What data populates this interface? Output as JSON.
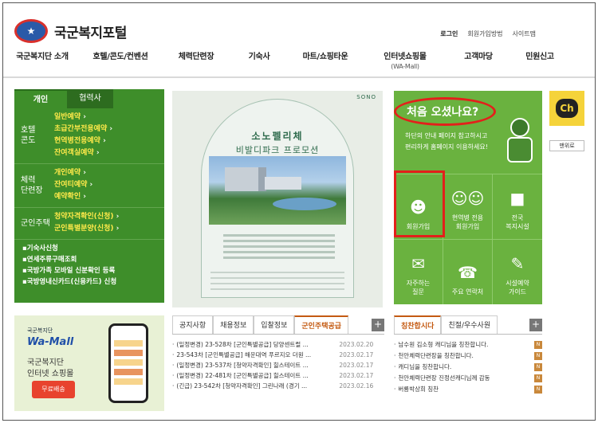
{
  "header": {
    "site_title": "국군복지포털",
    "util": {
      "login": "로그인",
      "join": "회원가입방법",
      "sitemap": "사이트맵"
    },
    "nav": [
      {
        "label": "국군복지단 소개",
        "sub": ""
      },
      {
        "label": "호텔/콘도/컨벤션",
        "sub": ""
      },
      {
        "label": "체력단련장",
        "sub": ""
      },
      {
        "label": "기숙사",
        "sub": ""
      },
      {
        "label": "마트/쇼핑타운",
        "sub": ""
      },
      {
        "label": "인터넷쇼핑몰",
        "sub": "(WA-Mall)"
      },
      {
        "label": "고객마당",
        "sub": ""
      },
      {
        "label": "민원신고",
        "sub": ""
      }
    ]
  },
  "left_menu": {
    "tabs": [
      "개인",
      "협력사"
    ],
    "sections": [
      {
        "title": "호텔\n콘도",
        "items": [
          "일반예약",
          "초급간부전용예약",
          "현역병전용예약",
          "잔여객실예약"
        ]
      },
      {
        "title": "체력\n단련장",
        "items": [
          "개인예약",
          "잔여티예약",
          "예약확인"
        ]
      },
      {
        "title": "군인주택",
        "items": [
          "청약자격확인(신청)",
          "군인특별분양(신청)"
        ]
      }
    ],
    "bullets": [
      "기숙사신청",
      "연세주류구매조회",
      "국방가족 모바일 신분확인 등록",
      "국방영내신카드(신용카드) 신청"
    ]
  },
  "banner": {
    "brand": "SONO",
    "title_line1": "소노펠리체",
    "title_line2": "비발디파크 프로모션"
  },
  "quick": {
    "hello": "처음 오셨나요?",
    "desc_line1": "하단의 안내 페이지 참고하시고",
    "desc_line2": "편리하게 홈페이지 이용하세요!",
    "cells": [
      {
        "icon": "user-icon",
        "label": "회원가입"
      },
      {
        "icon": "users-icon",
        "label": "현역병 전용\n회원가입"
      },
      {
        "icon": "building-icon",
        "label": "전국\n복지시설"
      },
      {
        "icon": "qa-icon",
        "label": "자주하는\n질문"
      },
      {
        "icon": "phone-icon",
        "label": "주요 연락처"
      },
      {
        "icon": "guide-icon",
        "label": "시설예약\n가이드"
      }
    ]
  },
  "channel": {
    "label": "Ch",
    "top_btn": "맨위로"
  },
  "wamall": {
    "brand": "국군복지단",
    "logo": "Wa-Mall",
    "line1": "국군복지단",
    "line2": "인터넷 쇼핑몰",
    "free_ship": "무료배송"
  },
  "notice": {
    "tabs": [
      "공지사항",
      "채용정보",
      "입찰정보",
      "군인주택공급"
    ],
    "active": 3,
    "plus": "+",
    "rows": [
      {
        "title": "(일정변경) 23-528차 [군인특별공급] 당양센트럴 ...",
        "date": "2023.02.20"
      },
      {
        "title": "23-543차 [군인특별공급] 해운대역 푸르지오 더원 ...",
        "date": "2023.02.17"
      },
      {
        "title": "(일정변경) 23-537차 [청약자격확인] 힐스테이트 ...",
        "date": "2023.02.17"
      },
      {
        "title": "(일정변경) 22-481차 [군인특별공급] 힐스테이트 ...",
        "date": "2023.02.17"
      },
      {
        "title": "(긴급) 23-542차 [청약자격확인] 그린나래 (경기 ...",
        "date": "2023.02.16"
      }
    ]
  },
  "praise": {
    "tabs": [
      "칭찬합시다",
      "친절/우수사원"
    ],
    "plus": "+",
    "rows": [
      "남수원 김소형 캐디님을 칭찬합니다.",
      "천안체력단련장을 칭찬합니다.",
      "캐디님을 칭찬합니다.",
      "천안체력단련장 진정선캐디님께 감동",
      "버룡박상희 칭찬"
    ],
    "badge": "N"
  }
}
